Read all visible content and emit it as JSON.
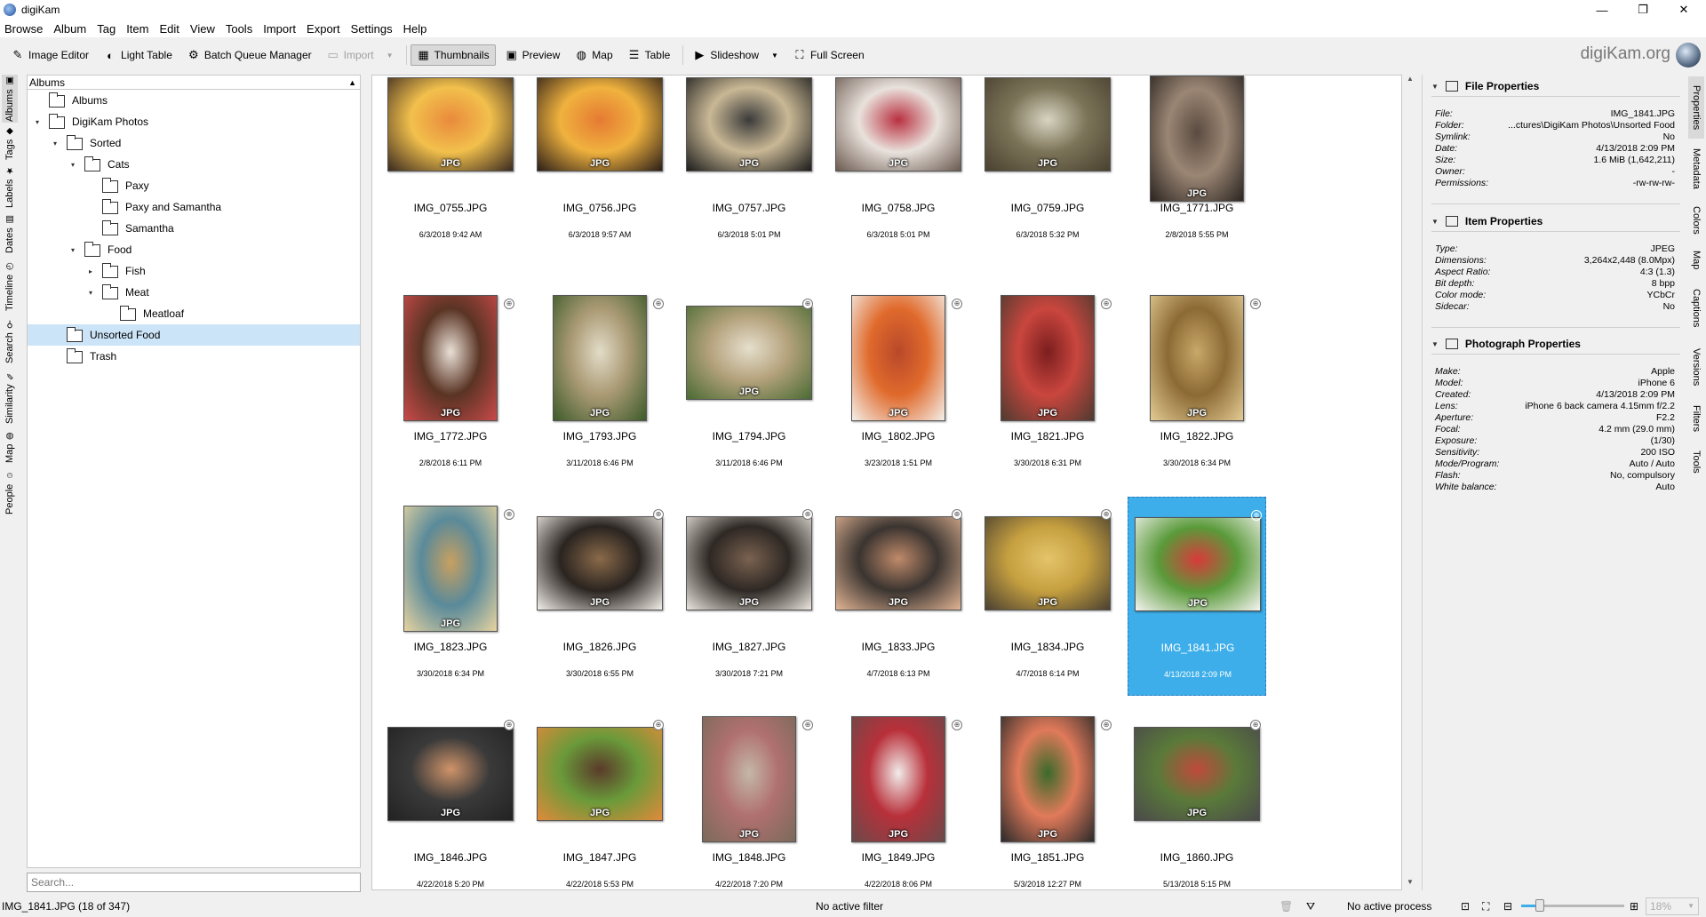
{
  "window": {
    "title": "digiKam",
    "controls": [
      "—",
      "❐",
      "✕"
    ]
  },
  "menu": [
    "Browse",
    "Album",
    "Tag",
    "Item",
    "Edit",
    "View",
    "Tools",
    "Import",
    "Export",
    "Settings",
    "Help"
  ],
  "toolbar": {
    "image_editor": "Image Editor",
    "light_table": "Light Table",
    "batch_queue": "Batch Queue Manager",
    "import": "Import",
    "thumbnails": "Thumbnails",
    "preview": "Preview",
    "map": "Map",
    "table": "Table",
    "slideshow": "Slideshow",
    "full_screen": "Full Screen",
    "brand": "digiKam.org"
  },
  "left_tabs": [
    "Albums",
    "Tags",
    "Labels",
    "Dates",
    "Timeline",
    "Search",
    "Similarity",
    "Map",
    "People"
  ],
  "albums": {
    "header": "Albums",
    "tree": [
      {
        "label": "Albums",
        "level": 0,
        "expander": ""
      },
      {
        "label": "DigiKam Photos",
        "level": 0,
        "expander": "▾"
      },
      {
        "label": "Sorted",
        "level": 1,
        "expander": "▾"
      },
      {
        "label": "Cats",
        "level": 2,
        "expander": "▾"
      },
      {
        "label": "Paxy",
        "level": 3,
        "expander": ""
      },
      {
        "label": "Paxy and Samantha",
        "level": 3,
        "expander": ""
      },
      {
        "label": "Samantha",
        "level": 3,
        "expander": ""
      },
      {
        "label": "Food",
        "level": 2,
        "expander": "▾"
      },
      {
        "label": "Fish",
        "level": 3,
        "expander": "▸"
      },
      {
        "label": "Meat",
        "level": 3,
        "expander": "▾"
      },
      {
        "label": "Meatloaf",
        "level": 4,
        "expander": ""
      },
      {
        "label": "Unsorted Food",
        "level": 1,
        "expander": "",
        "selected": true
      },
      {
        "label": "Trash",
        "level": 1,
        "expander": ""
      }
    ],
    "search_placeholder": "Search..."
  },
  "thumbs": [
    {
      "name": "IMG_0755.JPG",
      "date": "6/3/2018 9:42 AM",
      "badge": "JPG",
      "orient": "land",
      "colors": [
        "#e98a3c",
        "#f2c04c",
        "#3a2a20"
      ],
      "geo": false
    },
    {
      "name": "IMG_0756.JPG",
      "date": "6/3/2018 9:57 AM",
      "badge": "JPG",
      "orient": "land",
      "colors": [
        "#e57a33",
        "#f0b23e",
        "#2b1e18"
      ],
      "geo": false
    },
    {
      "name": "IMG_0757.JPG",
      "date": "6/3/2018 5:01 PM",
      "badge": "JPG",
      "orient": "land",
      "colors": [
        "#3b3b3b",
        "#c9b895",
        "#1c1c1c"
      ],
      "geo": false
    },
    {
      "name": "IMG_0758.JPG",
      "date": "6/3/2018 5:01 PM",
      "badge": "JPG",
      "orient": "land",
      "colors": [
        "#b93040",
        "#e9e2dc",
        "#6b5a50"
      ],
      "geo": false
    },
    {
      "name": "IMG_0759.JPG",
      "date": "6/3/2018 5:32 PM",
      "badge": "JPG",
      "orient": "land",
      "colors": [
        "#d8d4c2",
        "#7c7458",
        "#4a4030"
      ],
      "geo": false
    },
    {
      "name": "IMG_1771.JPG",
      "date": "2/8/2018 5:55 PM",
      "badge": "JPG",
      "orient": "port",
      "colors": [
        "#5a4a40",
        "#9b8674",
        "#2a2420"
      ],
      "geo": false
    },
    {
      "name": "IMG_1772.JPG",
      "date": "2/8/2018 6:11 PM",
      "badge": "JPG",
      "orient": "port",
      "colors": [
        "#e9e0d6",
        "#5a3424",
        "#c94a4a"
      ],
      "geo": true
    },
    {
      "name": "IMG_1793.JPG",
      "date": "3/11/2018 6:46 PM",
      "badge": "JPG",
      "orient": "port",
      "colors": [
        "#e2dcc8",
        "#aa9a74",
        "#3c5a2a"
      ],
      "geo": true
    },
    {
      "name": "IMG_1794.JPG",
      "date": "3/11/2018 6:46 PM",
      "badge": "JPG",
      "orient": "land",
      "colors": [
        "#e6dfcd",
        "#b4a27c",
        "#4a6a34"
      ],
      "geo": true
    },
    {
      "name": "IMG_1802.JPG",
      "date": "3/23/2018 1:51 PM",
      "badge": "JPG",
      "orient": "port",
      "colors": [
        "#b9482a",
        "#e06a2c",
        "#f4f0ea"
      ],
      "geo": true
    },
    {
      "name": "IMG_1821.JPG",
      "date": "3/30/2018 6:31 PM",
      "badge": "JPG",
      "orient": "port",
      "colors": [
        "#7a1e1e",
        "#c9463e",
        "#4e3a30"
      ],
      "geo": true
    },
    {
      "name": "IMG_1822.JPG",
      "date": "3/30/2018 6:34 PM",
      "badge": "JPG",
      "orient": "port",
      "colors": [
        "#c9a86a",
        "#8c6a34",
        "#e4cc94"
      ],
      "geo": true
    },
    {
      "name": "IMG_1823.JPG",
      "date": "3/30/2018 6:34 PM",
      "badge": "JPG",
      "orient": "port",
      "colors": [
        "#c8a060",
        "#5a8a9a",
        "#e8d4a0"
      ],
      "geo": true
    },
    {
      "name": "IMG_1826.JPG",
      "date": "3/30/2018 6:55 PM",
      "badge": "JPG",
      "orient": "land",
      "colors": [
        "#8a6a4a",
        "#2a2420",
        "#f2eee8"
      ],
      "geo": true
    },
    {
      "name": "IMG_1827.JPG",
      "date": "3/30/2018 7:21 PM",
      "badge": "JPG",
      "orient": "land",
      "colors": [
        "#7a6250",
        "#2e2824",
        "#ebe6de"
      ],
      "geo": true
    },
    {
      "name": "IMG_1833.JPG",
      "date": "4/7/2018 6:13 PM",
      "badge": "JPG",
      "orient": "land",
      "colors": [
        "#c08a6a",
        "#3a3430",
        "#e2b494"
      ],
      "geo": true
    },
    {
      "name": "IMG_1834.JPG",
      "date": "4/7/2018 6:14 PM",
      "badge": "JPG",
      "orient": "land",
      "colors": [
        "#e4c46a",
        "#c6a040",
        "#4a4030"
      ],
      "geo": true
    },
    {
      "name": "IMG_1841.JPG",
      "date": "4/13/2018 2:09 PM",
      "badge": "JPG",
      "orient": "land",
      "colors": [
        "#d83a3a",
        "#5a9a3a",
        "#f4f4f0"
      ],
      "geo": true,
      "selected": true
    },
    {
      "name": "IMG_1846.JPG",
      "date": "4/22/2018 5:20 PM",
      "badge": "JPG",
      "orient": "land",
      "colors": [
        "#d0946a",
        "#3a3a3a",
        "#222"
      ],
      "geo": true
    },
    {
      "name": "IMG_1847.JPG",
      "date": "4/22/2018 5:53 PM",
      "badge": "JPG",
      "orient": "land",
      "colors": [
        "#5a3a2a",
        "#6a9a3a",
        "#e08a3a"
      ],
      "geo": true
    },
    {
      "name": "IMG_1848.JPG",
      "date": "4/22/2018 7:20 PM",
      "badge": "JPG",
      "orient": "port",
      "colors": [
        "#c4b8a8",
        "#b07070",
        "#7a6a5a"
      ],
      "geo": true
    },
    {
      "name": "IMG_1849.JPG",
      "date": "4/22/2018 8:06 PM",
      "badge": "JPG",
      "orient": "port",
      "colors": [
        "#f2ecea",
        "#b8303a",
        "#6a4a4a"
      ],
      "geo": true
    },
    {
      "name": "IMG_1851.JPG",
      "date": "5/3/2018 12:27 PM",
      "badge": "JPG",
      "orient": "port",
      "colors": [
        "#3a6a2a",
        "#e07a5a",
        "#2a2a2a"
      ],
      "geo": true
    },
    {
      "name": "IMG_1860.JPG",
      "date": "5/13/2018 5:15 PM",
      "badge": "JPG",
      "orient": "land",
      "colors": [
        "#c04a3a",
        "#5a7a3a",
        "#4a4a4a"
      ],
      "geo": true
    }
  ],
  "right_tabs": [
    "Properties",
    "Metadata",
    "Colors",
    "Map",
    "Captions",
    "Versions",
    "Filters",
    "Tools"
  ],
  "properties": {
    "file": {
      "title": "File Properties",
      "rows": [
        {
          "k": "File:",
          "v": "IMG_1841.JPG"
        },
        {
          "k": "Folder:",
          "v": "...ctures\\DigiKam Photos\\Unsorted Food"
        },
        {
          "k": "Symlink:",
          "v": "No"
        },
        {
          "k": "Date:",
          "v": "4/13/2018 2:09 PM"
        },
        {
          "k": "Size:",
          "v": "1.6 MiB (1,642,211)"
        },
        {
          "k": "Owner:",
          "v": "-"
        },
        {
          "k": "Permissions:",
          "v": "-rw-rw-rw-"
        }
      ]
    },
    "item": {
      "title": "Item Properties",
      "rows": [
        {
          "k": "Type:",
          "v": "JPEG"
        },
        {
          "k": "Dimensions:",
          "v": "3,264x2,448 (8.0Mpx)"
        },
        {
          "k": "Aspect Ratio:",
          "v": "4:3 (1.3)"
        },
        {
          "k": "Bit depth:",
          "v": "8 bpp"
        },
        {
          "k": "Color mode:",
          "v": "YCbCr"
        },
        {
          "k": "Sidecar:",
          "v": "No"
        }
      ]
    },
    "photo": {
      "title": "Photograph Properties",
      "rows": [
        {
          "k": "Make:",
          "v": "Apple"
        },
        {
          "k": "Model:",
          "v": "iPhone 6"
        },
        {
          "k": "Created:",
          "v": "4/13/2018 2:09 PM"
        },
        {
          "k": "Lens:",
          "v": "iPhone 6 back camera 4.15mm f/2.2"
        },
        {
          "k": "Aperture:",
          "v": "F2.2"
        },
        {
          "k": "Focal:",
          "v": "4.2 mm (29.0 mm)"
        },
        {
          "k": "Exposure:",
          "v": "(1/30)"
        },
        {
          "k": "Sensitivity:",
          "v": "200 ISO"
        },
        {
          "k": "Mode/Program:",
          "v": "Auto / Auto"
        },
        {
          "k": "Flash:",
          "v": "No, compulsory"
        },
        {
          "k": "White balance:",
          "v": "Auto"
        }
      ]
    }
  },
  "status": {
    "item": "IMG_1841.JPG (18 of 347)",
    "filter": "No active filter",
    "process": "No active process",
    "zoom": "18%",
    "zoom_fraction": 0.18
  }
}
